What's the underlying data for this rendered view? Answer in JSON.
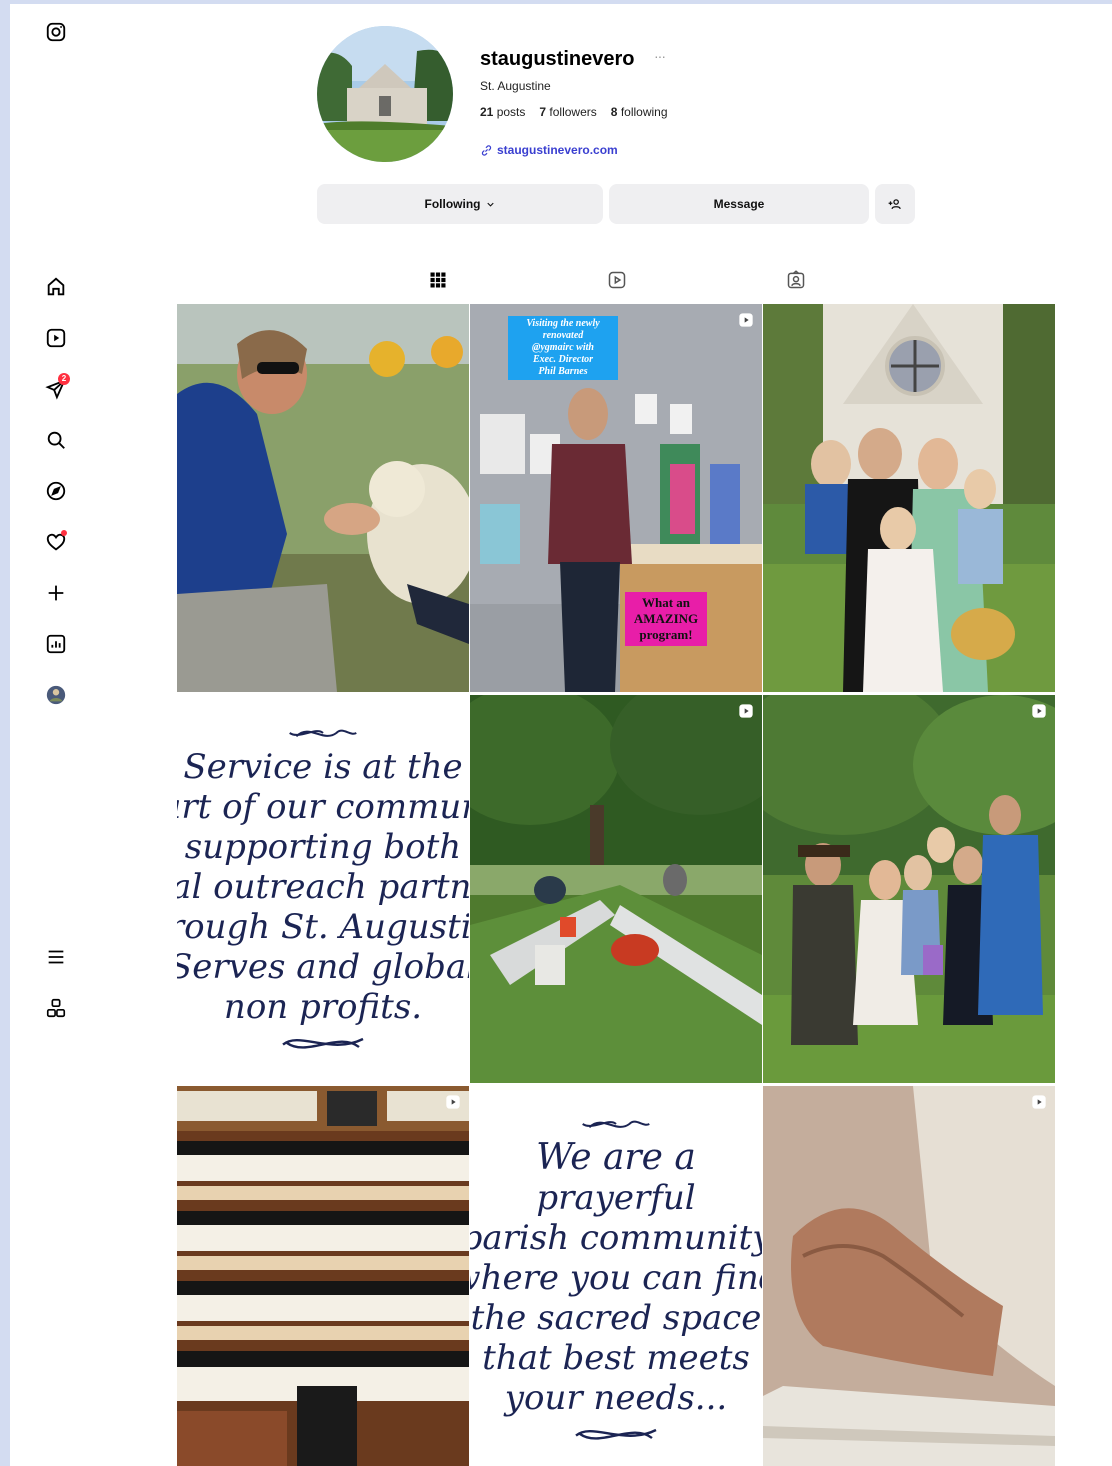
{
  "colors": {
    "page_bg": "#d3dcf1",
    "badge": "#ff3040",
    "link": "#3a3fd0",
    "button_bg": "#efeff1",
    "script_text": "#1b2453"
  },
  "sidebar": {
    "items": [
      {
        "name": "instagram-logo-icon"
      },
      {
        "name": "home-icon"
      },
      {
        "name": "reels-icon"
      },
      {
        "name": "messages-icon",
        "badge": "2"
      },
      {
        "name": "search-icon"
      },
      {
        "name": "explore-icon"
      },
      {
        "name": "notifications-icon"
      },
      {
        "name": "create-icon"
      },
      {
        "name": "dashboard-icon"
      },
      {
        "name": "profile-avatar-icon"
      },
      {
        "name": "menu-icon"
      },
      {
        "name": "also-from-meta-icon"
      }
    ]
  },
  "profile": {
    "username": "staugustinevero",
    "more": "···",
    "full_name": "St. Augustine",
    "posts_count": "21",
    "posts_label": "posts",
    "followers_count": "7",
    "followers_label": "followers",
    "following_count": "8",
    "following_label": "following",
    "link": "staugustinevero.com"
  },
  "actions": {
    "following_label": "Following",
    "message_label": "Message"
  },
  "tabs": [
    {
      "name": "posts-grid-icon",
      "active": true
    },
    {
      "name": "reels-tab-icon",
      "active": false
    },
    {
      "name": "tagged-tab-icon",
      "active": false
    }
  ],
  "posts": {
    "p2_top": [
      "Visiting the newly",
      "renovated",
      "@ygmairc with",
      "Exec. Director",
      "Phil Barnes"
    ],
    "p2_bottom": [
      "What an",
      "AMAZING",
      "program!"
    ],
    "p4_lines": [
      "Service is at the",
      "heart of our community",
      "supporting both",
      "local outreach partners",
      "through St. Augustine",
      "Serves and global",
      "non profits."
    ],
    "p8_lines": [
      "We are a",
      "prayerful",
      "parish community",
      "where you can find",
      "the sacred space",
      "that best meets",
      "your needs..."
    ]
  }
}
